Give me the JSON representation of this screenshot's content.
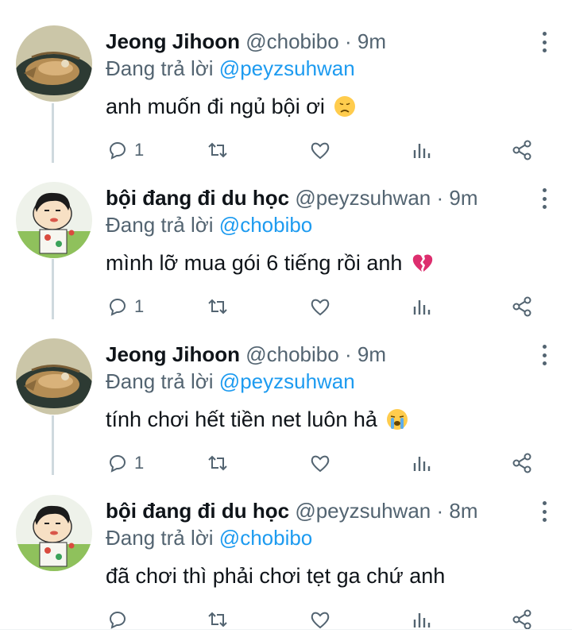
{
  "colors": {
    "text": "#0f1419",
    "muted": "#536471",
    "mention": "#1d9bf0",
    "thread_line": "#cfd9de"
  },
  "tweets": [
    {
      "avatar": "fish-food-photo",
      "name": "Jeong Jihoon",
      "handle": "@chobibo",
      "dot": "·",
      "time": "9m",
      "reply_prefix": "Đang trả lời",
      "reply_to": "@peyzsuhwan",
      "text": "anh muốn đi ngủ bội ơi",
      "emoji": "disappointed-face",
      "reply_count": "1",
      "actions": [
        "reply-icon",
        "retweet-icon",
        "like-icon",
        "views-icon",
        "share-icon"
      ]
    },
    {
      "avatar": "cartoon-boy",
      "name": "bội đang đi du học",
      "handle": "@peyzsuhwan",
      "dot": "·",
      "time": "9m",
      "reply_prefix": "Đang trả lời",
      "reply_to": "@chobibo",
      "text": "mình lỡ mua gói 6 tiếng rồi anh",
      "emoji": "broken-heart",
      "reply_count": "1",
      "actions": [
        "reply-icon",
        "retweet-icon",
        "like-icon",
        "views-icon",
        "share-icon"
      ]
    },
    {
      "avatar": "fish-food-photo",
      "name": "Jeong Jihoon",
      "handle": "@chobibo",
      "dot": "·",
      "time": "9m",
      "reply_prefix": "Đang trả lời",
      "reply_to": "@peyzsuhwan",
      "text": "tính chơi hết tiền net luôn hả",
      "emoji": "loudly-crying-face",
      "reply_count": "1",
      "actions": [
        "reply-icon",
        "retweet-icon",
        "like-icon",
        "views-icon",
        "share-icon"
      ]
    },
    {
      "avatar": "cartoon-boy",
      "name": "bội đang đi du học",
      "handle": "@peyzsuhwan",
      "dot": "·",
      "time": "8m",
      "reply_prefix": "Đang trả lời",
      "reply_to": "@chobibo",
      "text": "đã chơi thì phải chơi tẹt ga chứ anh",
      "emoji": "",
      "reply_count": "",
      "actions": [
        "reply-icon",
        "retweet-icon",
        "like-icon",
        "views-icon",
        "share-icon"
      ]
    }
  ]
}
